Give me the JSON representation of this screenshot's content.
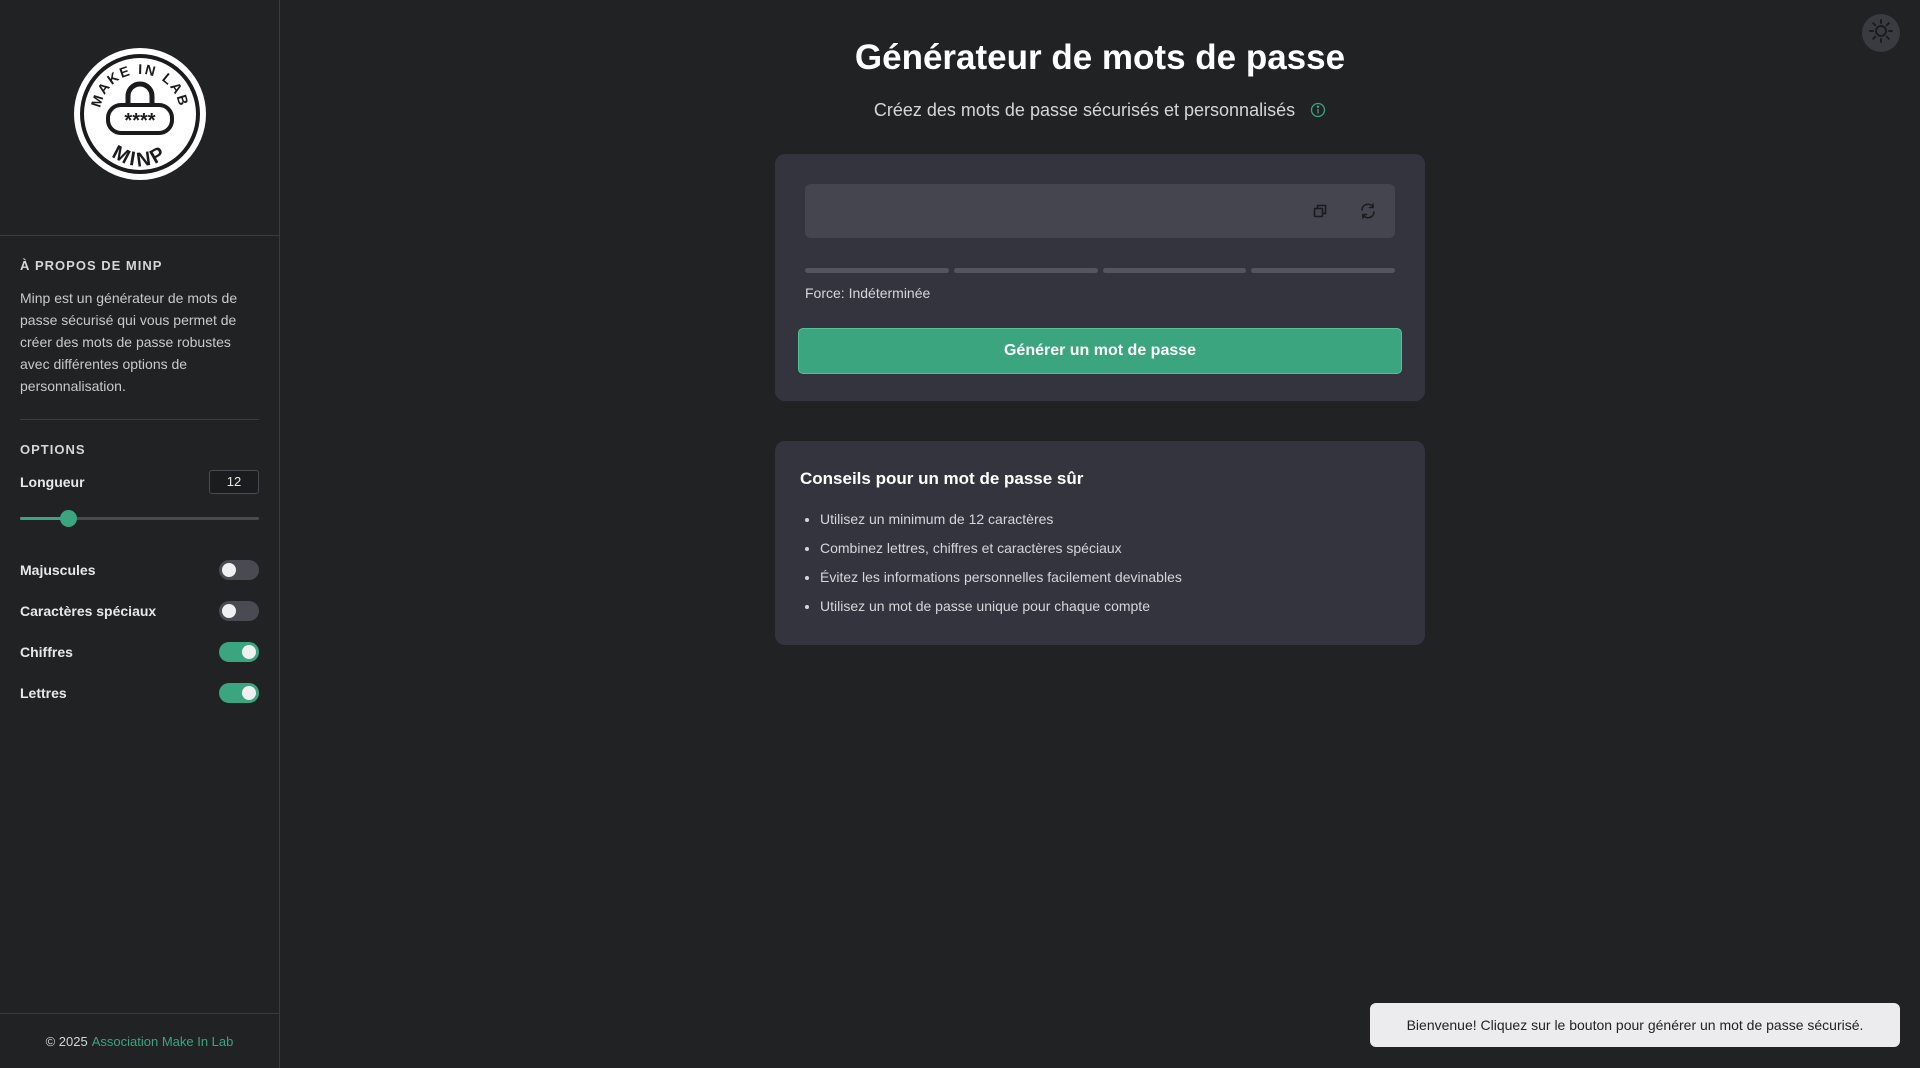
{
  "sidebar": {
    "logo": {
      "top_text": "MAKE IN LAB",
      "bottom_text": "MINP",
      "masked_text": "****"
    },
    "about": {
      "heading": "À PROPOS DE MINP",
      "text": "Minp est un générateur de mots de passe sécurisé qui vous permet de créer des mots de passe robustes avec différentes options de personnalisation."
    },
    "options": {
      "heading": "OPTIONS",
      "length_label": "Longueur",
      "length_value": "12",
      "length_fraction": 0.2,
      "toggles": [
        {
          "label": "Majuscules",
          "on": false
        },
        {
          "label": "Caractères spéciaux",
          "on": false
        },
        {
          "label": "Chiffres",
          "on": true
        },
        {
          "label": "Lettres",
          "on": true
        }
      ]
    },
    "footer": {
      "copyright": "© 2025",
      "link": "Association Make In Lab"
    }
  },
  "header": {
    "title": "Générateur de mots de passe",
    "subtitle": "Créez des mots de passe sécurisés et personnalisés"
  },
  "generator": {
    "password_value": "",
    "strength_label": "Force: Indéterminée",
    "strength_level": 0,
    "button_label": "Générer un mot de passe"
  },
  "tips": {
    "title": "Conseils pour un mot de passe sûr",
    "items": [
      "Utilisez un minimum de 12 caractères",
      "Combinez lettres, chiffres et caractères spéciaux",
      "Évitez les informations personnelles facilement devinables",
      "Utilisez un mot de passe unique pour chaque compte"
    ]
  },
  "toast": {
    "message": "Bienvenue! Cliquez sur le bouton pour générer un mot de passe sécurisé."
  },
  "colors": {
    "accent": "#3aa57e",
    "background": "#212224",
    "card": "#34343f"
  },
  "icons": {
    "copy": "copy-icon",
    "refresh": "refresh-icon",
    "info": "info-icon",
    "theme": "sun-icon"
  }
}
